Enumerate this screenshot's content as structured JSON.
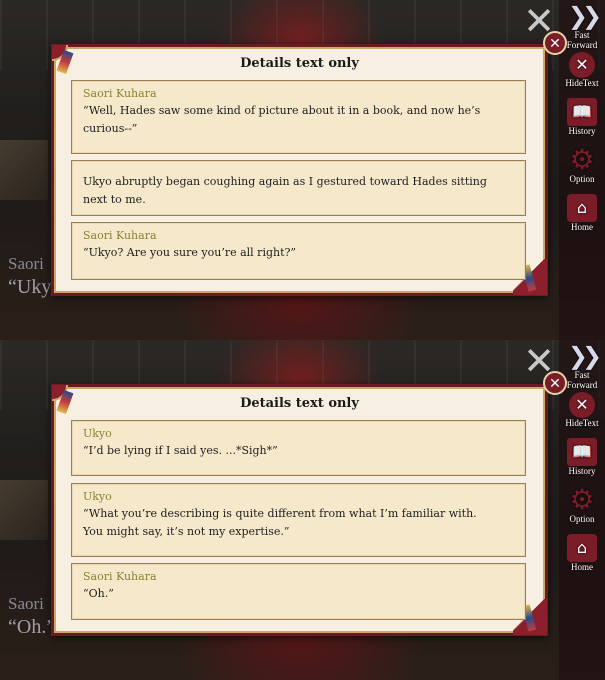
{
  "menu": {
    "fast_forward": "Fast Forward",
    "hide_text": "HideText",
    "history": "History",
    "option": "Option",
    "home": "Home",
    "icons": {
      "fast_forward": "double-chevron-icon",
      "hide_text": "x-circle-icon",
      "history": "book-icon",
      "option": "gear-icon",
      "home": "house-icon"
    }
  },
  "colors": {
    "accent": "#7a1d28",
    "speaker": "#8a8232",
    "parchment": "#f7f0e2"
  },
  "panels": [
    {
      "background_name": "Saori",
      "background_line": "“Ukyo",
      "dialog": {
        "title": "Details text only",
        "entries": [
          {
            "speaker": "Saori Kuhara",
            "lines": [
              "“Well, Hades saw some kind of picture about it in a book, and now he’s",
              "curious--”"
            ]
          },
          {
            "speaker": "",
            "lines": [
              "Ukyo abruptly began coughing again as I gestured toward Hades sitting",
              "next to me."
            ]
          },
          {
            "speaker": "Saori Kuhara",
            "lines": [
              "“Ukyo? Are you sure you’re all right?”",
              ""
            ]
          }
        ]
      }
    },
    {
      "background_name": "Saori",
      "background_line": "“Oh.”",
      "dialog": {
        "title": "Details text only",
        "entries": [
          {
            "speaker": "Ukyo",
            "lines": [
              "“I’d be lying if I said yes. ...*Sigh*”",
              ""
            ]
          },
          {
            "speaker": "Ukyo",
            "lines": [
              "“What you’re describing is quite different from what I’m familiar with.",
              "You might say, it’s not my expertise.”"
            ]
          },
          {
            "speaker": "Saori Kuhara",
            "lines": [
              "“Oh.”",
              ""
            ]
          }
        ]
      }
    }
  ]
}
